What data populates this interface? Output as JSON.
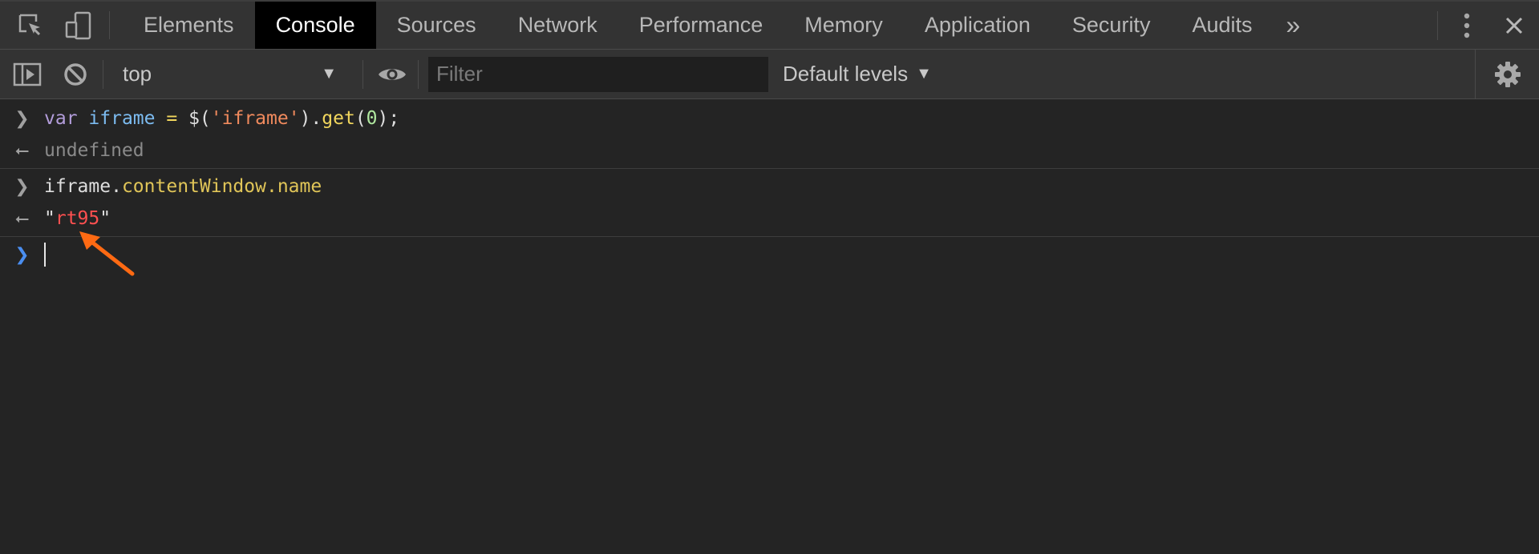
{
  "tabs": [
    "Elements",
    "Console",
    "Sources",
    "Network",
    "Performance",
    "Memory",
    "Application",
    "Security",
    "Audits"
  ],
  "active_tab_index": 1,
  "more_tabs_glyph": "»",
  "close_glyph": "✕",
  "toolbar": {
    "context": "top",
    "filter_placeholder": "Filter",
    "levels": "Default levels"
  },
  "console": {
    "line1": {
      "kw": "var",
      "name": "iframe",
      "eq": "=",
      "dollar": "$(",
      "str": "'iframe'",
      "close_dot": ").",
      "method": "get",
      "open": "(",
      "num": "0",
      "end": ");"
    },
    "result1": "undefined",
    "line2": {
      "obj": "iframe",
      "dot": ".",
      "prop": "contentWindow.name"
    },
    "result2": {
      "quote_open": "\"",
      "value": "rt95",
      "quote_close": "\""
    }
  },
  "colors": {
    "accent_blue": "#4a8ef0",
    "annotation_arrow": "#ff6a13",
    "string_value": "#ff5050"
  }
}
